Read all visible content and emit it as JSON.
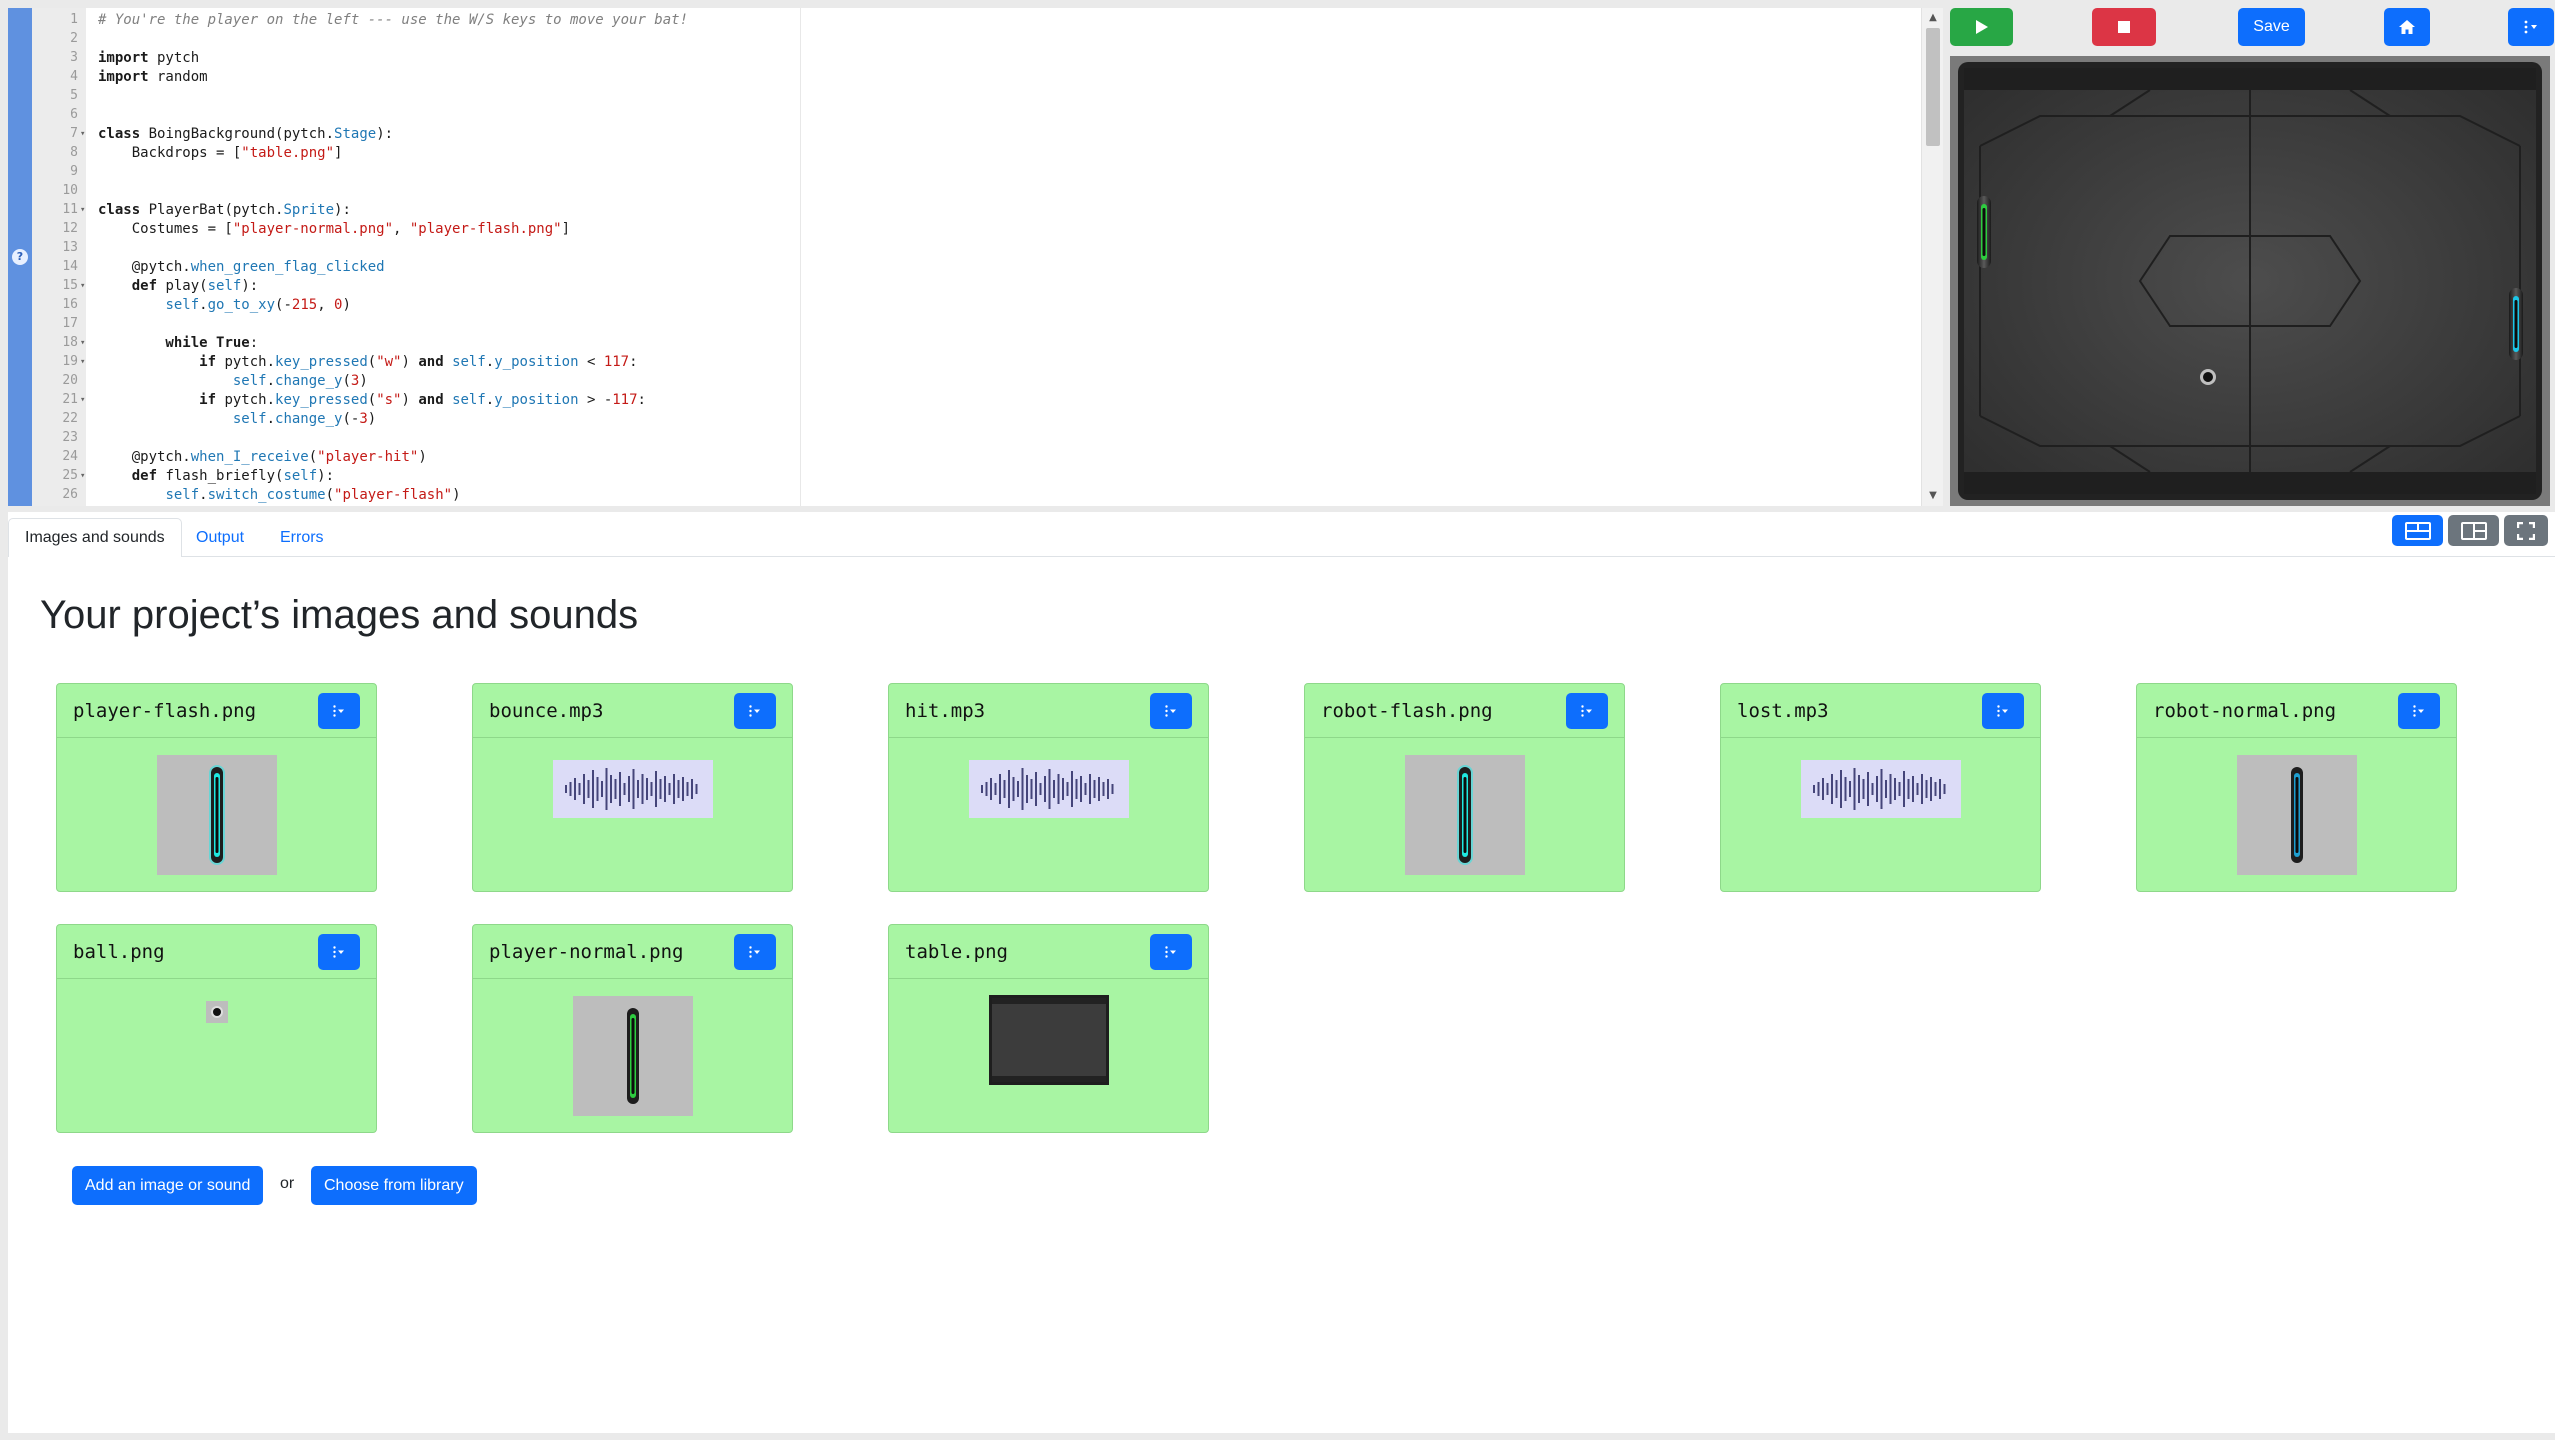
{
  "editor": {
    "lines": [
      {
        "n": "1",
        "fold": false,
        "parts": [
          {
            "t": "# You're the player on the left --- use the W/S keys to move your bat!",
            "c": "cmt"
          }
        ]
      },
      {
        "n": "2",
        "fold": false,
        "parts": []
      },
      {
        "n": "3",
        "fold": false,
        "parts": [
          {
            "t": "import",
            "c": "kw"
          },
          {
            "t": " pytch",
            "c": ""
          }
        ]
      },
      {
        "n": "4",
        "fold": false,
        "parts": [
          {
            "t": "import",
            "c": "kw"
          },
          {
            "t": " random",
            "c": ""
          }
        ]
      },
      {
        "n": "5",
        "fold": false,
        "parts": []
      },
      {
        "n": "6",
        "fold": false,
        "parts": []
      },
      {
        "n": "7",
        "fold": true,
        "parts": [
          {
            "t": "class",
            "c": "kw"
          },
          {
            "t": " BoingBackground(pytch.",
            "c": ""
          },
          {
            "t": "Stage",
            "c": "fn"
          },
          {
            "t": "):",
            "c": ""
          }
        ]
      },
      {
        "n": "8",
        "fold": false,
        "parts": [
          {
            "t": "    Backdrops = [",
            "c": ""
          },
          {
            "t": "\"table.png\"",
            "c": "str"
          },
          {
            "t": "]",
            "c": ""
          }
        ]
      },
      {
        "n": "9",
        "fold": false,
        "parts": []
      },
      {
        "n": "10",
        "fold": false,
        "parts": []
      },
      {
        "n": "11",
        "fold": true,
        "parts": [
          {
            "t": "class",
            "c": "kw"
          },
          {
            "t": " PlayerBat(pytch.",
            "c": ""
          },
          {
            "t": "Sprite",
            "c": "fn"
          },
          {
            "t": "):",
            "c": ""
          }
        ]
      },
      {
        "n": "12",
        "fold": false,
        "parts": [
          {
            "t": "    Costumes = [",
            "c": ""
          },
          {
            "t": "\"player-normal.png\"",
            "c": "str"
          },
          {
            "t": ", ",
            "c": ""
          },
          {
            "t": "\"player-flash.png\"",
            "c": "str"
          },
          {
            "t": "]",
            "c": ""
          }
        ]
      },
      {
        "n": "13",
        "fold": false,
        "parts": []
      },
      {
        "n": "14",
        "fold": false,
        "parts": [
          {
            "t": "    @pytch.",
            "c": ""
          },
          {
            "t": "when_green_flag_clicked",
            "c": "fn"
          }
        ]
      },
      {
        "n": "15",
        "fold": true,
        "parts": [
          {
            "t": "    def",
            "c": "kw"
          },
          {
            "t": " play(",
            "c": ""
          },
          {
            "t": "self",
            "c": "fn"
          },
          {
            "t": "):",
            "c": ""
          }
        ]
      },
      {
        "n": "16",
        "fold": false,
        "parts": [
          {
            "t": "        ",
            "c": ""
          },
          {
            "t": "self",
            "c": "fn"
          },
          {
            "t": ".",
            "c": ""
          },
          {
            "t": "go_to_xy",
            "c": "fn"
          },
          {
            "t": "(-",
            "c": ""
          },
          {
            "t": "215",
            "c": "num"
          },
          {
            "t": ", ",
            "c": ""
          },
          {
            "t": "0",
            "c": "num"
          },
          {
            "t": ")",
            "c": ""
          }
        ]
      },
      {
        "n": "17",
        "fold": false,
        "parts": []
      },
      {
        "n": "18",
        "fold": true,
        "parts": [
          {
            "t": "        while",
            "c": "kw"
          },
          {
            "t": " ",
            "c": ""
          },
          {
            "t": "True",
            "c": "kw"
          },
          {
            "t": ":",
            "c": ""
          }
        ]
      },
      {
        "n": "19",
        "fold": true,
        "parts": [
          {
            "t": "            if",
            "c": "kw"
          },
          {
            "t": " pytch.",
            "c": ""
          },
          {
            "t": "key_pressed",
            "c": "fn"
          },
          {
            "t": "(",
            "c": ""
          },
          {
            "t": "\"w\"",
            "c": "str"
          },
          {
            "t": ") ",
            "c": ""
          },
          {
            "t": "and",
            "c": "kw"
          },
          {
            "t": " ",
            "c": ""
          },
          {
            "t": "self",
            "c": "fn"
          },
          {
            "t": ".",
            "c": ""
          },
          {
            "t": "y_position",
            "c": "fn"
          },
          {
            "t": " < ",
            "c": ""
          },
          {
            "t": "117",
            "c": "num"
          },
          {
            "t": ":",
            "c": ""
          }
        ]
      },
      {
        "n": "20",
        "fold": false,
        "parts": [
          {
            "t": "                ",
            "c": ""
          },
          {
            "t": "self",
            "c": "fn"
          },
          {
            "t": ".",
            "c": ""
          },
          {
            "t": "change_y",
            "c": "fn"
          },
          {
            "t": "(",
            "c": ""
          },
          {
            "t": "3",
            "c": "num"
          },
          {
            "t": ")",
            "c": ""
          }
        ]
      },
      {
        "n": "21",
        "fold": true,
        "parts": [
          {
            "t": "            if",
            "c": "kw"
          },
          {
            "t": " pytch.",
            "c": ""
          },
          {
            "t": "key_pressed",
            "c": "fn"
          },
          {
            "t": "(",
            "c": ""
          },
          {
            "t": "\"s\"",
            "c": "str"
          },
          {
            "t": ") ",
            "c": ""
          },
          {
            "t": "and",
            "c": "kw"
          },
          {
            "t": " ",
            "c": ""
          },
          {
            "t": "self",
            "c": "fn"
          },
          {
            "t": ".",
            "c": ""
          },
          {
            "t": "y_position",
            "c": "fn"
          },
          {
            "t": " > -",
            "c": ""
          },
          {
            "t": "117",
            "c": "num"
          },
          {
            "t": ":",
            "c": ""
          }
        ]
      },
      {
        "n": "22",
        "fold": false,
        "parts": [
          {
            "t": "                ",
            "c": ""
          },
          {
            "t": "self",
            "c": "fn"
          },
          {
            "t": ".",
            "c": ""
          },
          {
            "t": "change_y",
            "c": "fn"
          },
          {
            "t": "(-",
            "c": ""
          },
          {
            "t": "3",
            "c": "num"
          },
          {
            "t": ")",
            "c": ""
          }
        ]
      },
      {
        "n": "23",
        "fold": false,
        "parts": []
      },
      {
        "n": "24",
        "fold": false,
        "parts": [
          {
            "t": "    @pytch.",
            "c": ""
          },
          {
            "t": "when_I_receive",
            "c": "fn"
          },
          {
            "t": "(",
            "c": ""
          },
          {
            "t": "\"player-hit\"",
            "c": "str"
          },
          {
            "t": ")",
            "c": ""
          }
        ]
      },
      {
        "n": "25",
        "fold": true,
        "parts": [
          {
            "t": "    def",
            "c": "kw"
          },
          {
            "t": " flash_briefly(",
            "c": ""
          },
          {
            "t": "self",
            "c": "fn"
          },
          {
            "t": "):",
            "c": ""
          }
        ]
      },
      {
        "n": "26",
        "fold": false,
        "parts": [
          {
            "t": "        ",
            "c": ""
          },
          {
            "t": "self",
            "c": "fn"
          },
          {
            "t": ".",
            "c": ""
          },
          {
            "t": "switch_costume",
            "c": "fn"
          },
          {
            "t": "(",
            "c": ""
          },
          {
            "t": "\"player-flash\"",
            "c": "str"
          },
          {
            "t": ")",
            "c": ""
          }
        ]
      }
    ]
  },
  "controls": {
    "green_flag_icon": "play-icon",
    "stop_icon": "stop-icon",
    "save_label": "Save",
    "home_icon": "home-icon",
    "menu_icon": "kebab-menu-icon"
  },
  "tabs": [
    {
      "label": "Images and sounds",
      "active": true
    },
    {
      "label": "Output",
      "active": false
    },
    {
      "label": "Errors",
      "active": false
    }
  ],
  "assets": {
    "title": "Your project’s images and sounds",
    "items": [
      {
        "name": "player-flash.png",
        "kind": "image",
        "preview": "bat-flash"
      },
      {
        "name": "bounce.mp3",
        "kind": "sound"
      },
      {
        "name": "hit.mp3",
        "kind": "sound"
      },
      {
        "name": "robot-flash.png",
        "kind": "image",
        "preview": "bat-flash"
      },
      {
        "name": "lost.mp3",
        "kind": "sound"
      },
      {
        "name": "robot-normal.png",
        "kind": "image",
        "preview": "bat-normal-blue"
      },
      {
        "name": "ball.png",
        "kind": "image",
        "preview": "ball"
      },
      {
        "name": "player-normal.png",
        "kind": "image",
        "preview": "bat-normal-green"
      },
      {
        "name": "table.png",
        "kind": "image",
        "preview": "table"
      }
    ],
    "add_label": "Add an image or sound",
    "or_label": "or",
    "library_label": "Choose from library"
  },
  "colors": {
    "card_bg": "#a8f5a3",
    "primary": "#0d6efd",
    "success": "#28a745",
    "danger": "#dc3545",
    "editor_edge": "#5f91e0"
  }
}
